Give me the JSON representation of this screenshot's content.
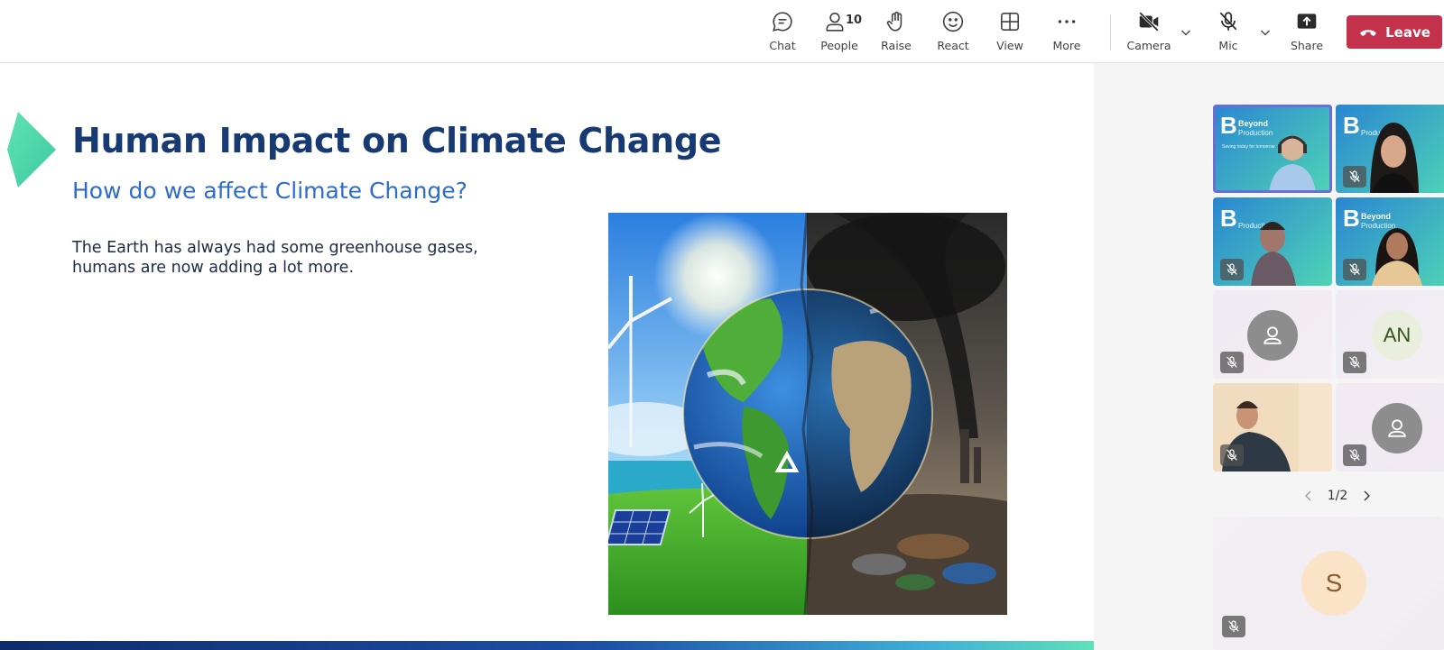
{
  "toolbar": {
    "chat_label": "Chat",
    "people_label": "People",
    "people_count": "10",
    "raise_label": "Raise",
    "react_label": "React",
    "view_label": "View",
    "more_label": "More",
    "camera_label": "Camera",
    "mic_label": "Mic",
    "share_label": "Share",
    "leave_label": "Leave"
  },
  "slide": {
    "title": "Human Impact on Climate Change",
    "subtitle": "How do we affect Climate Change?",
    "body_line1": "The Earth has always had some greenhouse gases,",
    "body_line2": "humans are now adding a lot more."
  },
  "gallery": {
    "brand_name_1": "Beyond",
    "brand_name_2": "Production",
    "brand_tagline": "Saving today for tomorrow",
    "initials_an": "AN",
    "initials_s": "S",
    "pager_text": "1/2"
  },
  "colors": {
    "leave": "#c4314b",
    "title": "#173a72",
    "subtitle": "#2d6cc8",
    "active_tile": "#6b6fd4"
  }
}
